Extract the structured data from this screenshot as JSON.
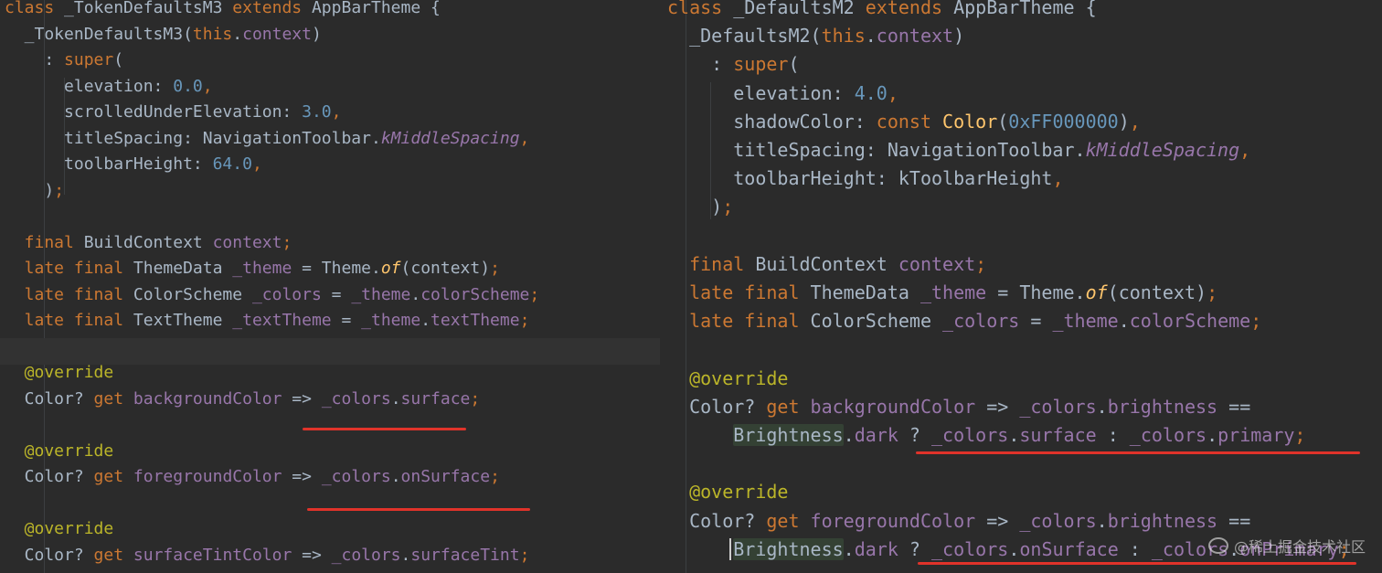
{
  "left": {
    "lines": [
      [
        [
          "kw",
          "class "
        ],
        [
          "typ",
          "_TokenDefaultsM3 "
        ],
        [
          "kw",
          "extends "
        ],
        [
          "typ",
          "AppBarTheme {"
        ]
      ],
      [
        [
          "typ",
          "  _TokenDefaultsM3("
        ],
        [
          "kw",
          "this"
        ],
        [
          "typ",
          "."
        ],
        [
          "fld",
          "context"
        ],
        [
          "typ",
          ")"
        ]
      ],
      [
        [
          "typ",
          "    : "
        ],
        [
          "kw",
          "super"
        ],
        [
          "typ",
          "("
        ]
      ],
      [
        [
          "typ",
          "      elevation: "
        ],
        [
          "num",
          "0.0"
        ],
        [
          "kw",
          ","
        ]
      ],
      [
        [
          "typ",
          "      scrolledUnderElevation: "
        ],
        [
          "num",
          "3.0"
        ],
        [
          "kw",
          ","
        ]
      ],
      [
        [
          "typ",
          "      titleSpacing: NavigationToolbar."
        ],
        [
          "it",
          "kMiddleSpacing"
        ],
        [
          "kw",
          ","
        ]
      ],
      [
        [
          "typ",
          "      toolbarHeight: "
        ],
        [
          "num",
          "64.0"
        ],
        [
          "kw",
          ","
        ]
      ],
      [
        [
          "typ",
          "    )"
        ],
        [
          "kw",
          ";"
        ]
      ],
      [],
      [
        [
          "kw",
          "  final "
        ],
        [
          "typ",
          "BuildContext "
        ],
        [
          "fld",
          "context"
        ],
        [
          "kw",
          ";"
        ]
      ],
      [
        [
          "kw",
          "  late final "
        ],
        [
          "typ",
          "ThemeData "
        ],
        [
          "fld",
          "_theme"
        ],
        [
          "typ",
          " = Theme."
        ],
        [
          "fn",
          "of"
        ],
        [
          "typ",
          "(context)"
        ],
        [
          "kw",
          ";"
        ]
      ],
      [
        [
          "kw",
          "  late final "
        ],
        [
          "typ",
          "ColorScheme "
        ],
        [
          "fld",
          "_colors"
        ],
        [
          "typ",
          " = "
        ],
        [
          "fld",
          "_theme"
        ],
        [
          "typ",
          "."
        ],
        [
          "fld",
          "colorScheme"
        ],
        [
          "kw",
          ";"
        ]
      ],
      [
        [
          "kw",
          "  late final "
        ],
        [
          "typ",
          "TextTheme "
        ],
        [
          "fld",
          "_textTheme"
        ],
        [
          "typ",
          " = "
        ],
        [
          "fld",
          "_theme"
        ],
        [
          "typ",
          "."
        ],
        [
          "fld",
          "textTheme"
        ],
        [
          "kw",
          ";"
        ]
      ],
      [],
      [
        [
          "ann",
          "  @override"
        ]
      ],
      [
        [
          "typ",
          "  Color? "
        ],
        [
          "kw",
          "get "
        ],
        [
          "fld",
          "backgroundColor"
        ],
        [
          "typ",
          " => "
        ],
        [
          "fld",
          "_colors"
        ],
        [
          "typ",
          "."
        ],
        [
          "fld",
          "surface"
        ],
        [
          "kw",
          ";"
        ]
      ],
      [],
      [
        [
          "ann",
          "  @override"
        ]
      ],
      [
        [
          "typ",
          "  Color? "
        ],
        [
          "kw",
          "get "
        ],
        [
          "fld",
          "foregroundColor"
        ],
        [
          "typ",
          " => "
        ],
        [
          "fld",
          "_colors"
        ],
        [
          "typ",
          "."
        ],
        [
          "fld",
          "onSurface"
        ],
        [
          "kw",
          ";"
        ]
      ],
      [],
      [
        [
          "ann",
          "  @override"
        ]
      ],
      [
        [
          "typ",
          "  Color? "
        ],
        [
          "kw",
          "get "
        ],
        [
          "fld",
          "surfaceTintColor"
        ],
        [
          "typ",
          " => "
        ],
        [
          "fld",
          "_colors"
        ],
        [
          "typ",
          "."
        ],
        [
          "fld",
          "surfaceTint"
        ],
        [
          "kw",
          ";"
        ]
      ]
    ]
  },
  "right": {
    "lines": [
      [
        [
          "kw",
          "class "
        ],
        [
          "typ",
          "_DefaultsM2 "
        ],
        [
          "kw",
          "extends "
        ],
        [
          "typ",
          "AppBarTheme {"
        ]
      ],
      [
        [
          "typ",
          "  _DefaultsM2("
        ],
        [
          "kw",
          "this"
        ],
        [
          "typ",
          "."
        ],
        [
          "fld",
          "context"
        ],
        [
          "typ",
          ")"
        ]
      ],
      [
        [
          "typ",
          "    : "
        ],
        [
          "kw",
          "super"
        ],
        [
          "typ",
          "("
        ]
      ],
      [
        [
          "typ",
          "      elevation: "
        ],
        [
          "num",
          "4.0"
        ],
        [
          "kw",
          ","
        ]
      ],
      [
        [
          "typ",
          "      shadowColor: "
        ],
        [
          "kw",
          "const "
        ],
        [
          "lit",
          "Color"
        ],
        [
          "typ",
          "("
        ],
        [
          "num",
          "0xFF000000"
        ],
        [
          "typ",
          ")"
        ],
        [
          "kw",
          ","
        ]
      ],
      [
        [
          "typ",
          "      titleSpacing: NavigationToolbar."
        ],
        [
          "it",
          "kMiddleSpacing"
        ],
        [
          "kw",
          ","
        ]
      ],
      [
        [
          "typ",
          "      toolbarHeight: kToolbarHeight"
        ],
        [
          "kw",
          ","
        ]
      ],
      [
        [
          "typ",
          "    )"
        ],
        [
          "kw",
          ";"
        ]
      ],
      [],
      [
        [
          "kw",
          "  final "
        ],
        [
          "typ",
          "BuildContext "
        ],
        [
          "fld",
          "context"
        ],
        [
          "kw",
          ";"
        ]
      ],
      [
        [
          "kw",
          "  late final "
        ],
        [
          "typ",
          "ThemeData "
        ],
        [
          "fld",
          "_theme"
        ],
        [
          "typ",
          " = Theme."
        ],
        [
          "fn",
          "of"
        ],
        [
          "typ",
          "(context)"
        ],
        [
          "kw",
          ";"
        ]
      ],
      [
        [
          "kw",
          "  late final "
        ],
        [
          "typ",
          "ColorScheme "
        ],
        [
          "fld",
          "_colors"
        ],
        [
          "typ",
          " = "
        ],
        [
          "fld",
          "_theme"
        ],
        [
          "typ",
          "."
        ],
        [
          "fld",
          "colorScheme"
        ],
        [
          "kw",
          ";"
        ]
      ],
      [],
      [
        [
          "ann",
          "  @override"
        ]
      ],
      [
        [
          "typ",
          "  Color? "
        ],
        [
          "kw",
          "get "
        ],
        [
          "fld",
          "backgroundColor"
        ],
        [
          "typ",
          " => "
        ],
        [
          "fld",
          "_colors"
        ],
        [
          "typ",
          "."
        ],
        [
          "fld",
          "brightness"
        ],
        [
          "typ",
          " =="
        ]
      ],
      [
        [
          "typ",
          "      "
        ],
        [
          "hl",
          "Brightness"
        ],
        [
          "typ",
          "."
        ],
        [
          "fld",
          "dark"
        ],
        [
          "typ",
          " ? "
        ],
        [
          "fld",
          "_colors"
        ],
        [
          "typ",
          "."
        ],
        [
          "fld",
          "surface"
        ],
        [
          "typ",
          " : "
        ],
        [
          "fld",
          "_colors"
        ],
        [
          "typ",
          "."
        ],
        [
          "fld",
          "primary"
        ],
        [
          "kw",
          ";"
        ]
      ],
      [],
      [
        [
          "ann",
          "  @override"
        ]
      ],
      [
        [
          "typ",
          "  Color? "
        ],
        [
          "kw",
          "get "
        ],
        [
          "fld",
          "foregroundColor"
        ],
        [
          "typ",
          " => "
        ],
        [
          "fld",
          "_colors"
        ],
        [
          "typ",
          "."
        ],
        [
          "fld",
          "brightness"
        ],
        [
          "typ",
          " =="
        ]
      ],
      [
        [
          "typ",
          "      "
        ],
        [
          "hl",
          "Brightness"
        ],
        [
          "typ",
          "."
        ],
        [
          "fld",
          "dark"
        ],
        [
          "typ",
          " ? "
        ],
        [
          "fld",
          "_colors"
        ],
        [
          "typ",
          "."
        ],
        [
          "fld",
          "onSurface"
        ],
        [
          "typ",
          " : "
        ],
        [
          "fld",
          "_colors"
        ],
        [
          "typ",
          "."
        ],
        [
          "fld",
          "onPrimary"
        ],
        [
          "kw",
          ";"
        ]
      ]
    ]
  },
  "watermark": "@稀土掘金技术社区",
  "colors": {
    "background": "#2b2b2b",
    "keyword": "#cc7832",
    "number": "#6897bb",
    "field": "#9876aa",
    "annotation": "#bbb529",
    "text": "#a9b7c6",
    "underline": "#e0332a"
  }
}
